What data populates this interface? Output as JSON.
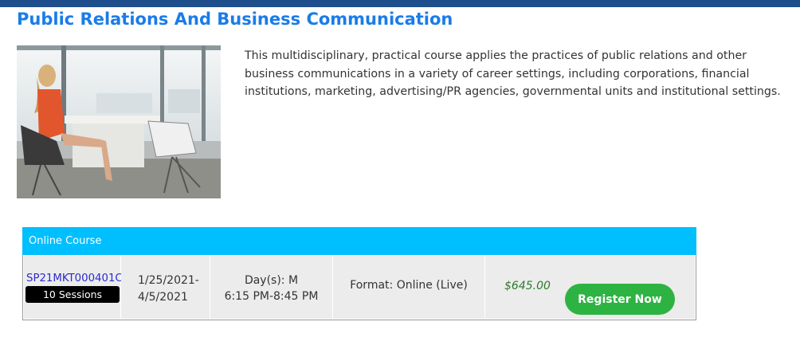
{
  "course": {
    "title": "Public Relations And Business Communication",
    "description": "This multidisciplinary, practical course applies the practices of public relations and other business communications in a variety of career settings, including corporations, financial institutions, marketing, advertising/PR agencies, governmental units and institutional settings."
  },
  "section": {
    "header": "Online Course",
    "code": "SP21MKT000401C",
    "sessions": "10 Sessions",
    "date_start": "1/25/2021-",
    "date_end": "4/5/2021",
    "days": "Day(s): M",
    "time": "6:15 PM-8:45 PM",
    "format": "Format: Online (Live)",
    "price": "$645.00",
    "register_label": "Register Now"
  },
  "colors": {
    "title": "#1a7ce8",
    "header_bg": "#00bfff",
    "register_bg": "#2db342",
    "price": "#2d7a2d",
    "code_link": "#2b2bd0"
  }
}
